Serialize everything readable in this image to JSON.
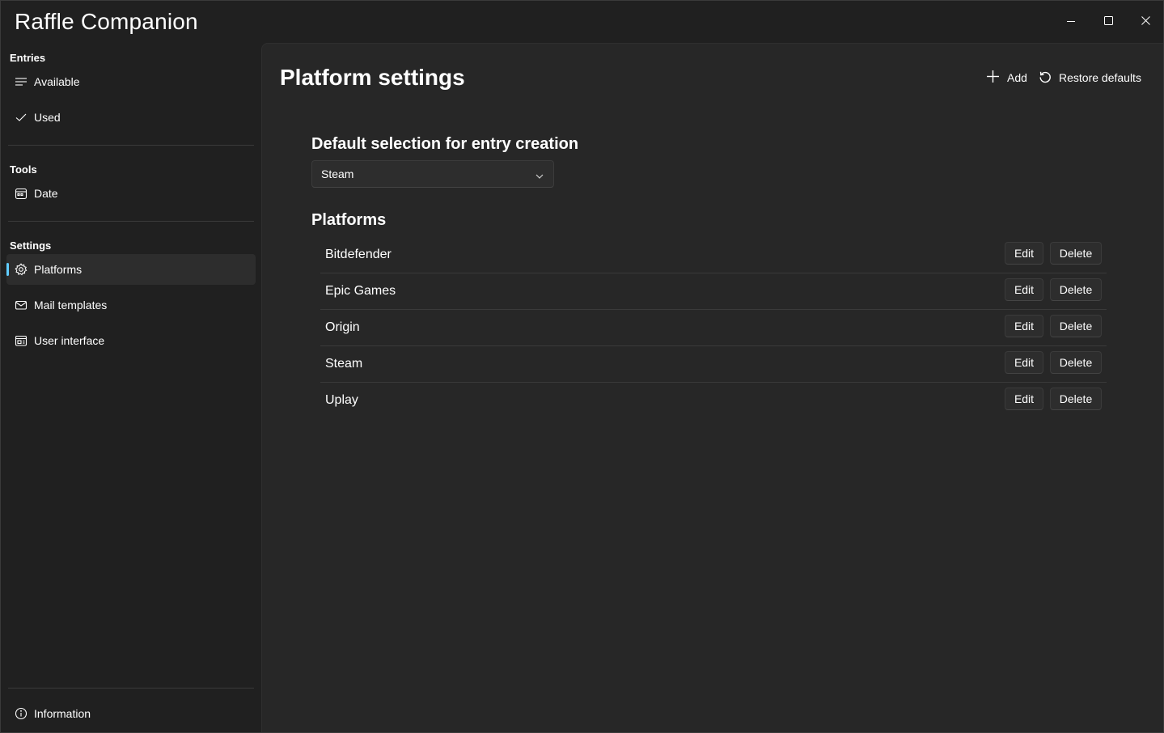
{
  "app": {
    "title": "Raffle Companion"
  },
  "window_controls": {
    "minimize": "minimize-icon",
    "maximize": "maximize-icon",
    "close": "close-icon"
  },
  "sidebar": {
    "sections": [
      {
        "header": "Entries",
        "items": [
          {
            "label": "Available",
            "icon": "list-icon"
          },
          {
            "label": "Used",
            "icon": "checkmark-icon"
          }
        ]
      },
      {
        "header": "Tools",
        "items": [
          {
            "label": "Date",
            "icon": "calendar-icon"
          }
        ]
      },
      {
        "header": "Settings",
        "items": [
          {
            "label": "Platforms",
            "icon": "gear-icon",
            "selected": true
          },
          {
            "label": "Mail templates",
            "icon": "mail-icon"
          },
          {
            "label": "User interface",
            "icon": "window-icon"
          }
        ]
      }
    ],
    "footer": {
      "label": "Information",
      "icon": "info-icon"
    },
    "accent_color": "#60cdff"
  },
  "page": {
    "title": "Platform settings",
    "commands": {
      "add": "Add",
      "restore": "Restore defaults"
    },
    "default_selection": {
      "label": "Default selection for entry creation",
      "value": "Steam"
    },
    "platforms": {
      "title": "Platforms",
      "edit_label": "Edit",
      "delete_label": "Delete",
      "items": [
        {
          "name": "Bitdefender"
        },
        {
          "name": "Epic Games"
        },
        {
          "name": "Origin"
        },
        {
          "name": "Steam"
        },
        {
          "name": "Uplay"
        }
      ]
    }
  }
}
